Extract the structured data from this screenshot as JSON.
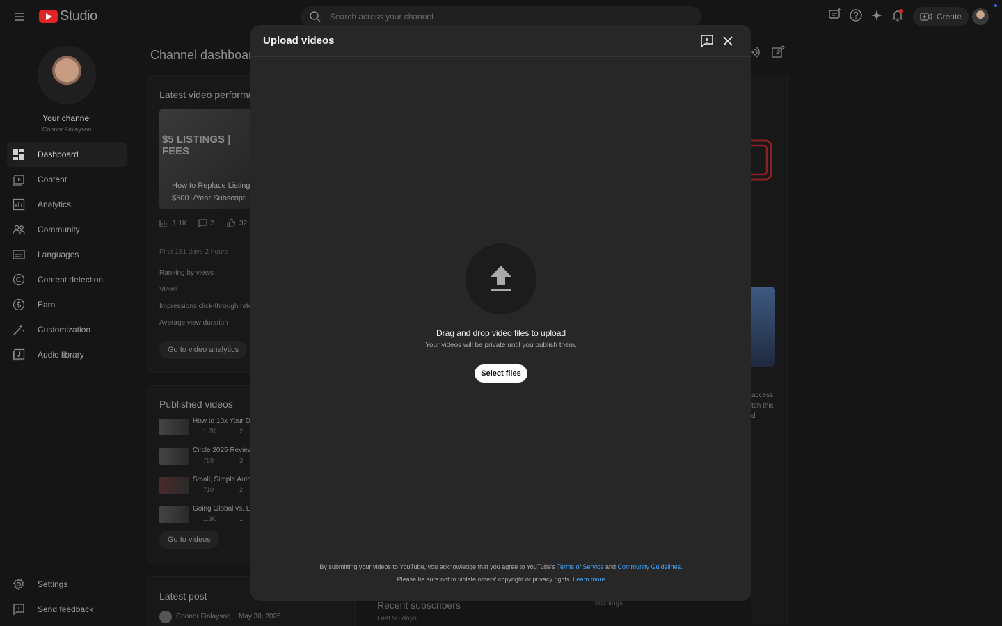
{
  "header": {
    "logo_text": "Studio",
    "search_placeholder": "Search across your channel",
    "create_label": "Create"
  },
  "sidebar": {
    "channel_name": "Your channel",
    "channel_handle": "Connor Finlayson",
    "items": [
      {
        "label": "Dashboard",
        "icon": "dashboard-icon",
        "active": true
      },
      {
        "label": "Content",
        "icon": "content-icon"
      },
      {
        "label": "Analytics",
        "icon": "analytics-icon"
      },
      {
        "label": "Community",
        "icon": "community-icon"
      },
      {
        "label": "Languages",
        "icon": "languages-icon"
      },
      {
        "label": "Content detection",
        "icon": "copyright-icon"
      },
      {
        "label": "Earn",
        "icon": "dollar-icon"
      },
      {
        "label": "Customization",
        "icon": "magic-wand-icon"
      },
      {
        "label": "Audio library",
        "icon": "audio-library-icon"
      }
    ],
    "bottom_items": [
      {
        "label": "Settings",
        "icon": "gear-icon"
      },
      {
        "label": "Send feedback",
        "icon": "feedback-icon"
      }
    ]
  },
  "dashboard": {
    "title": "Channel dashboard",
    "latest_video": {
      "card_title": "Latest video performa",
      "thumb_overlay": "$5 LISTINGS | FEES",
      "thumb_line1": "How to Replace Listing",
      "thumb_line2": "$500+/Year Subscripti",
      "views": "1.1K",
      "comments": "2",
      "likes": "32",
      "period": "First 181 days 2 hours",
      "metrics": [
        "Ranking by views",
        "Views",
        "Impressions click-through rate",
        "Average view duration"
      ],
      "button": "Go to video analytics"
    },
    "published": {
      "card_title": "Published videos",
      "videos": [
        {
          "title": "How to 10x Your D",
          "views": "1.7K",
          "comments": "2"
        },
        {
          "title": "Circle 2025 Review:",
          "views": "769",
          "comments": "3"
        },
        {
          "title": "Small, Simple Autor",
          "views": "710",
          "comments": "2"
        },
        {
          "title": "Going Global vs. Lo",
          "views": "1.3K",
          "comments": "1"
        }
      ],
      "button": "Go to videos"
    },
    "latest_post": {
      "card_title": "Latest post",
      "author": "Connor Finlayson",
      "date": "May 30, 2025"
    },
    "recent_subscribers": {
      "title": "Recent subscribers",
      "period": "Last 90 days"
    },
    "right_snippets": [
      "access",
      "tch this",
      "d",
      "warnings"
    ]
  },
  "modal": {
    "title": "Upload videos",
    "drop_title": "Drag and drop video files to upload",
    "drop_subtitle": "Your videos will be private until you publish them.",
    "select_button": "Select files",
    "legal_line1_prefix": "By submitting your videos to YouTube, you acknowledge that you agree to YouTube's ",
    "terms_link": "Terms of Service",
    "legal_and": " and ",
    "guidelines_link": "Community Guidelines",
    "legal_period": ".",
    "legal_line2_prefix": "Please be sure not to violate others' copyright or privacy rights. ",
    "learn_more_link": "Learn more"
  },
  "colors": {
    "background": "#151515",
    "modal": "#272727",
    "accent_link": "#3ea6ff",
    "brand_red": "#e02424"
  }
}
